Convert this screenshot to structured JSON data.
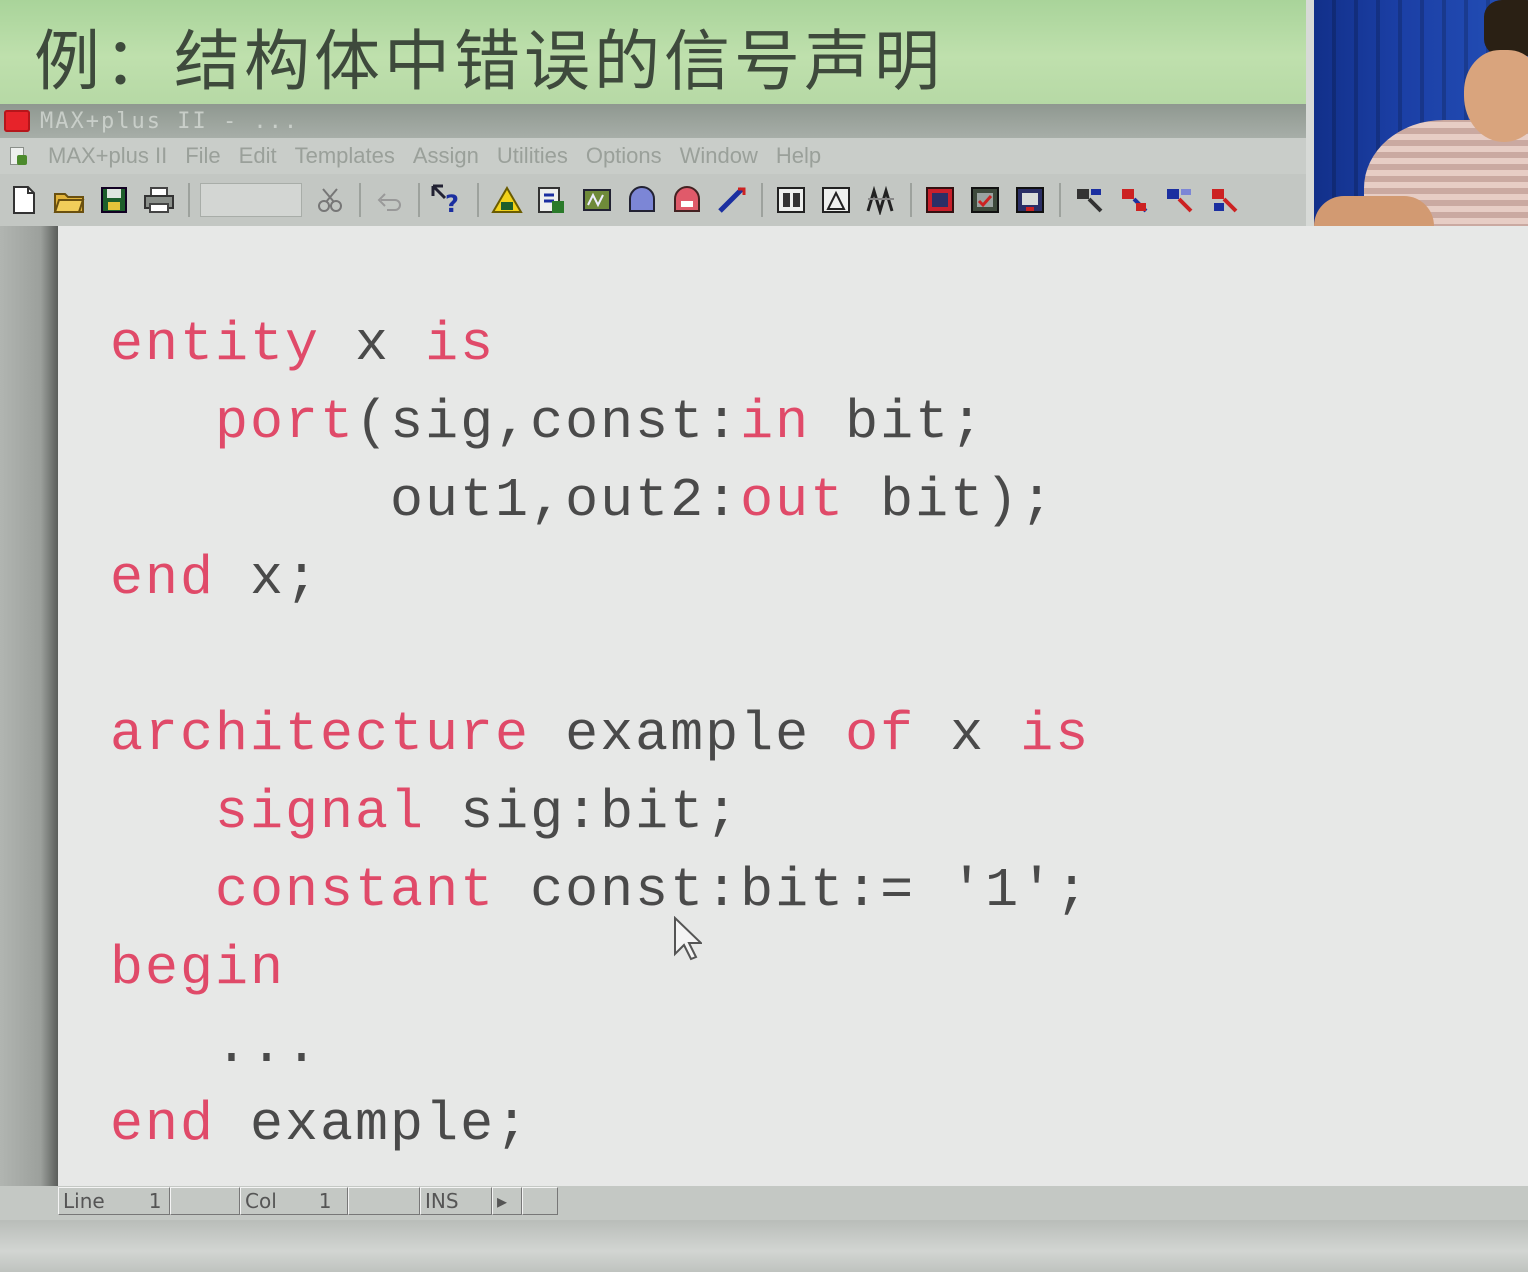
{
  "slide": {
    "title": "例：结构体中错误的信号声明"
  },
  "window": {
    "title": "MAX+plus II - ...",
    "menu_items": [
      "MAX+plus II",
      "File",
      "Edit",
      "Templates",
      "Assign",
      "Utilities",
      "Options",
      "Window",
      "Help"
    ]
  },
  "toolbar": {
    "icons": [
      "new-file-icon",
      "open-folder-icon",
      "save-icon",
      "print-icon",
      "font-field",
      "cut-icon",
      "undo-icon",
      "help-icon",
      "hierarchy-icon",
      "compiler-icon",
      "simulator-icon",
      "timing-icon",
      "programmer-icon",
      "graphic-editor-icon",
      "floorplan-icon",
      "symbol-icon",
      "waveform-icon",
      "project-icon",
      "save-check-icon",
      "compile-run-icon",
      "sim-run-icon",
      "timing-run-icon",
      "program-run-icon"
    ]
  },
  "editor": {
    "lines": [
      [
        {
          "t": "entity",
          "k": true
        },
        {
          "t": " x "
        },
        {
          "t": "is",
          "k": true
        }
      ],
      [
        {
          "t": "   "
        },
        {
          "t": "port",
          "k": true
        },
        {
          "t": "(sig,const:"
        },
        {
          "t": "in",
          "k": true
        },
        {
          "t": " bit;"
        }
      ],
      [
        {
          "t": "        out1,out2:"
        },
        {
          "t": "out",
          "k": true
        },
        {
          "t": " bit);"
        }
      ],
      [
        {
          "t": "end",
          "k": true
        },
        {
          "t": " x;"
        }
      ],
      [],
      [
        {
          "t": "architecture",
          "k": true
        },
        {
          "t": " example "
        },
        {
          "t": "of",
          "k": true
        },
        {
          "t": " x "
        },
        {
          "t": "is",
          "k": true
        }
      ],
      [
        {
          "t": "   "
        },
        {
          "t": "signal",
          "k": true
        },
        {
          "t": " sig:bit;"
        }
      ],
      [
        {
          "t": "   "
        },
        {
          "t": "constant",
          "k": true
        },
        {
          "t": " const:bit:= '1';"
        }
      ],
      [
        {
          "t": "begin",
          "k": true
        }
      ],
      [
        {
          "t": "   ..."
        }
      ],
      [
        {
          "t": "end",
          "k": true
        },
        {
          "t": " example;"
        }
      ]
    ]
  },
  "statusbar": {
    "line_label": "Line",
    "line_value": "1",
    "col_label": "Col",
    "col_value": "1",
    "mode": "INS"
  },
  "colors": {
    "keyword": "#e04a69",
    "code_text": "#4a4a4a",
    "title_band": "#b6d9a5"
  }
}
